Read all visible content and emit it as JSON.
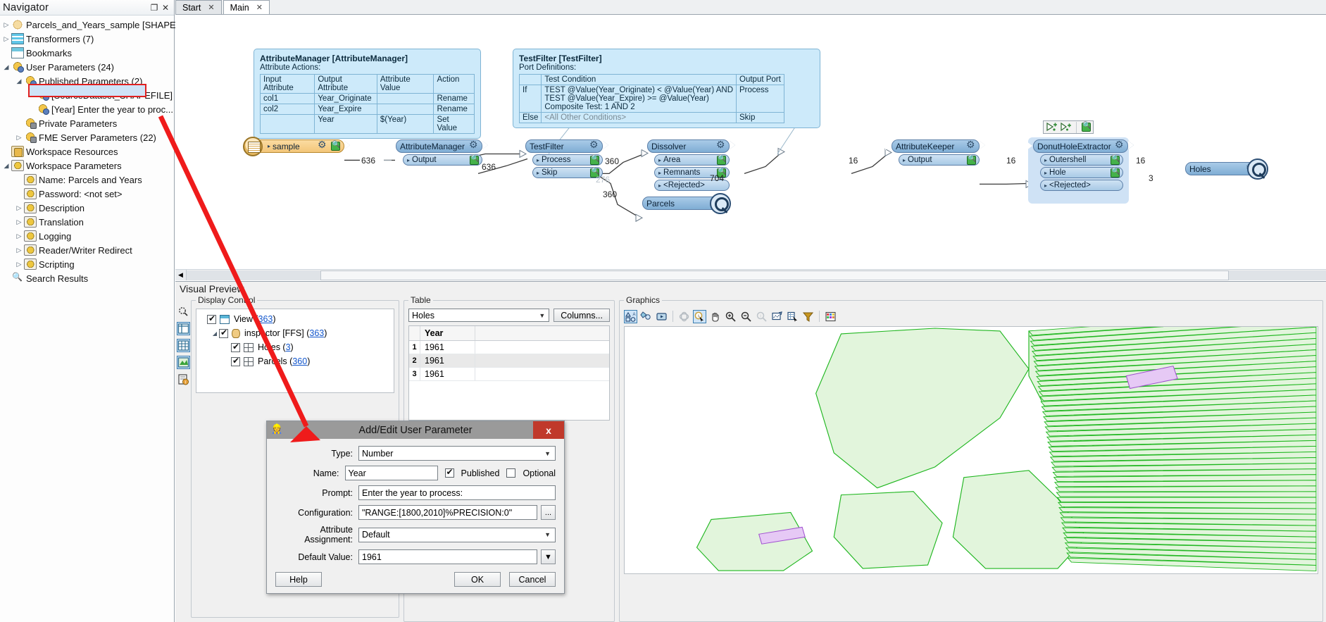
{
  "navigator": {
    "title": "Navigator",
    "restore_label": "❐",
    "close_label": "✕",
    "items": [
      {
        "label": "Parcels_and_Years_sample [SHAPEF...",
        "icon": "reader-icon",
        "indent": 1,
        "twisty": "▷"
      },
      {
        "label": "Transformers (7)",
        "icon": "transformers-icon",
        "indent": 1,
        "twisty": "▷"
      },
      {
        "label": "Bookmarks",
        "icon": "bookmarks-icon",
        "indent": 1,
        "twisty": ""
      },
      {
        "label": "User Parameters (24)",
        "icon": "user-parameters-icon",
        "indent": 1,
        "twisty": "◢"
      },
      {
        "label": "Published Parameters (2)",
        "icon": "published-parameters-icon",
        "indent": 2,
        "twisty": "◢"
      },
      {
        "label": "[SourceDataset_SHAPEFILE] ...",
        "icon": "parameter-icon",
        "indent": 3,
        "twisty": ""
      },
      {
        "label": "[Year] Enter the year to proc...",
        "icon": "parameter-icon",
        "indent": 3,
        "twisty": "",
        "selected": true
      },
      {
        "label": "Private Parameters",
        "icon": "private-parameters-icon",
        "indent": 2,
        "twisty": ""
      },
      {
        "label": "FME Server Parameters (22)",
        "icon": "server-parameters-icon",
        "indent": 2,
        "twisty": "▷"
      },
      {
        "label": "Workspace Resources",
        "icon": "workspace-resources-icon",
        "indent": 1,
        "twisty": ""
      },
      {
        "label": "Workspace Parameters",
        "icon": "workspace-parameters-icon",
        "indent": 1,
        "twisty": "◢"
      },
      {
        "label": "Name: Parcels and Years",
        "icon": "workspace-parameters-icon",
        "indent": 2,
        "twisty": ""
      },
      {
        "label": "Password: <not set>",
        "icon": "workspace-parameters-icon",
        "indent": 2,
        "twisty": ""
      },
      {
        "label": "Description",
        "icon": "workspace-parameters-icon",
        "indent": 2,
        "twisty": "▷"
      },
      {
        "label": "Translation",
        "icon": "workspace-parameters-icon",
        "indent": 2,
        "twisty": "▷"
      },
      {
        "label": "Logging",
        "icon": "workspace-parameters-icon",
        "indent": 2,
        "twisty": "▷"
      },
      {
        "label": "Reader/Writer Redirect",
        "icon": "workspace-parameters-icon",
        "indent": 2,
        "twisty": "▷"
      },
      {
        "label": "Scripting",
        "icon": "workspace-parameters-icon",
        "indent": 2,
        "twisty": "▷"
      },
      {
        "label": "Search Results",
        "icon": "search-icon",
        "indent": 1,
        "twisty": ""
      }
    ]
  },
  "tabs": [
    {
      "label": "Start",
      "close": "✕",
      "active": false
    },
    {
      "label": "Main",
      "close": "✕",
      "active": true
    }
  ],
  "canvas": {
    "attribute_manager_tooltip": {
      "title": "AttributeManager [AttributeManager]",
      "subtitle": "Attribute Actions:",
      "headers": [
        "Input Attribute",
        "Output Attribute",
        "Attribute Value",
        "Action"
      ],
      "rows": [
        [
          "col1",
          "Year_Originate",
          "",
          "Rename"
        ],
        [
          "col2",
          "Year_Expire",
          "",
          "Rename"
        ],
        [
          "",
          "Year",
          "$(Year)",
          "Set Value"
        ]
      ]
    },
    "test_filter_tooltip": {
      "title": "TestFilter [TestFilter]",
      "subtitle": "Port Definitions:",
      "headers": [
        "",
        "Test Condition",
        "Output Port"
      ],
      "rows": [
        [
          "If",
          "TEST @Value(Year_Originate) < @Value(Year) AND\nTEST @Value(Year_Expire) >= @Value(Year)\nComposite Test: 1 AND 2",
          "Process"
        ],
        [
          "Else",
          "<All Other Conditions>",
          "Skip"
        ]
      ]
    },
    "nodes": {
      "sample": {
        "label": "sample"
      },
      "attribute_manager": {
        "label": "AttributeManager",
        "ports": [
          "Output"
        ]
      },
      "test_filter": {
        "label": "TestFilter",
        "ports": [
          "Process",
          "Skip"
        ]
      },
      "dissolver": {
        "label": "Dissolver",
        "ports": [
          "Area",
          "Remnants",
          "<Rejected>"
        ]
      },
      "parcels": {
        "label": "Parcels"
      },
      "attribute_keeper": {
        "label": "AttributeKeeper",
        "ports": [
          "Output"
        ]
      },
      "donut_hole_extractor": {
        "label": "DonutHoleExtractor",
        "ports": [
          "Outershell",
          "Hole",
          "<Rejected>"
        ]
      },
      "holes": {
        "label": "Holes"
      }
    },
    "feature_counts": {
      "sample_to_am": "636",
      "am_to_tf": "636",
      "tf_process_to_dissolver": "360",
      "tf_skip": "276",
      "tf_process_to_parcels": "360",
      "dissolver_area": "16",
      "dissolver_remnants": "704",
      "keeper_out": "16",
      "dhe_outershell": "16",
      "dhe_hole": "3"
    }
  },
  "visual_preview": {
    "title": "Visual Preview",
    "display_control": {
      "legend": "Display Control",
      "rows": [
        {
          "label": "View",
          "count": "363",
          "indent": 0,
          "checked": true,
          "icon": "view-icon",
          "twisty": ""
        },
        {
          "label": "inspector [FFS]",
          "count": "363",
          "indent": 1,
          "checked": true,
          "icon": "dataset-icon",
          "twisty": "◢"
        },
        {
          "label": "Holes",
          "count": "3",
          "indent": 2,
          "checked": true,
          "icon": "layer-icon",
          "twisty": ""
        },
        {
          "label": "Parcels",
          "count": "360",
          "indent": 2,
          "checked": true,
          "icon": "layer-icon",
          "twisty": ""
        }
      ]
    },
    "table": {
      "legend": "Table",
      "selected_layer": "Holes",
      "columns_button": "Columns...",
      "headers": [
        "Year"
      ],
      "rows": [
        {
          "num": "1",
          "year": "1961"
        },
        {
          "num": "2",
          "year": "1961"
        },
        {
          "num": "3",
          "year": "1961"
        }
      ]
    },
    "graphics": {
      "legend": "Graphics",
      "tools": [
        "display-properties-icon",
        "symbology-icon",
        "presentation-icon",
        "sep",
        "rotate-icon",
        "info-select-icon",
        "pan-icon",
        "zoom-in-icon",
        "zoom-out-icon",
        "identify-icon",
        "zoom-extents-icon",
        "select-features-icon",
        "filter-icon",
        "sep",
        "color-grid-icon"
      ],
      "map_fill": "#e2f5dc",
      "map_stroke": "#1eb61e",
      "map_highlight": "#e6c9f5"
    }
  },
  "dialog": {
    "title": "Add/Edit User Parameter",
    "close_label": "x",
    "fields": {
      "type_label": "Type:",
      "type_value": "Number",
      "name_label": "Name:",
      "name_value": "Year",
      "published_label": "Published",
      "published_checked": true,
      "optional_label": "Optional",
      "optional_checked": false,
      "prompt_label": "Prompt:",
      "prompt_value": "Enter the year to process:",
      "configuration_label": "Configuration:",
      "configuration_value": "\"RANGE:[1800,2010]%PRECISION:0\"",
      "configuration_browse": "...",
      "attribute_assignment_label": "Attribute Assignment:",
      "attribute_assignment_value": "Default",
      "default_value_label": "Default Value:",
      "default_value": "1961"
    },
    "buttons": {
      "help": "Help",
      "ok": "OK",
      "cancel": "Cancel"
    }
  },
  "colors": {
    "accent_blue": "#7fadd4",
    "tooltip_blue": "#cdeafa",
    "selection_red": "#e02020",
    "port_green": "#45b24a"
  }
}
